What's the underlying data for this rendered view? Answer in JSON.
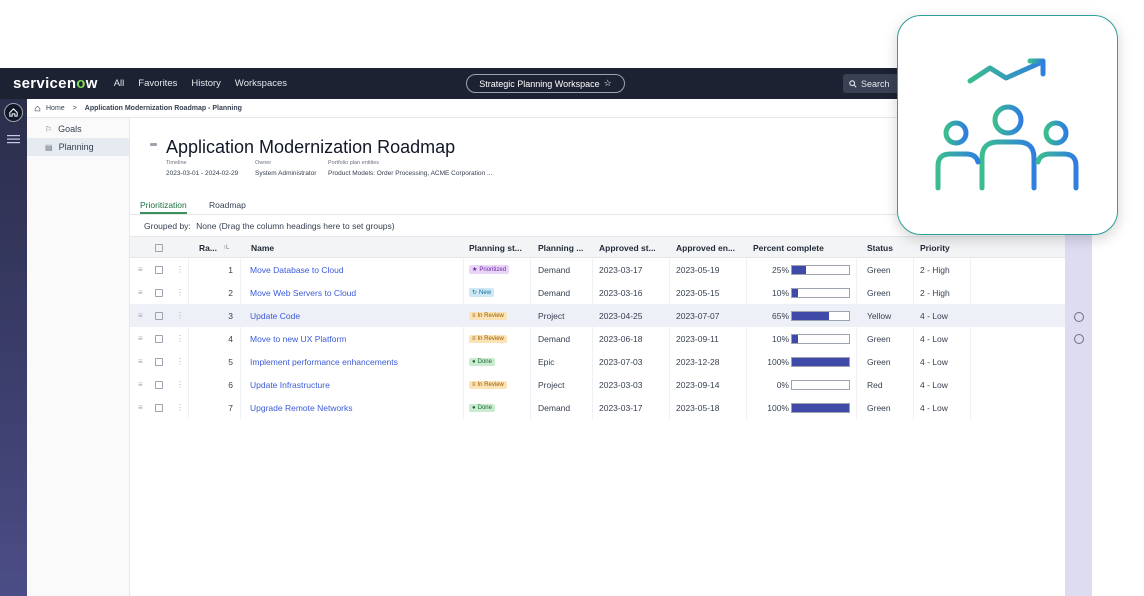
{
  "topbar": {
    "logo_left": "servicen",
    "logo_o": "o",
    "logo_right": "w",
    "nav": [
      "All",
      "Favorites",
      "History",
      "Workspaces"
    ],
    "workspace": "Strategic Planning Workspace",
    "star": "☆",
    "search": "Search"
  },
  "breadcrumb": {
    "home": "Home",
    "sep": ">",
    "current": "Application Modernization Roadmap - Planning"
  },
  "sidenav": {
    "items": [
      {
        "icon": "⚐",
        "label": "Goals"
      },
      {
        "icon": "▤",
        "label": "Planning"
      }
    ]
  },
  "header": {
    "title": "Application Modernization Roadmap",
    "timeline_label": "Timeline",
    "timeline_value": "2023-03-01 - 2024-02-29",
    "owner_label": "Owner",
    "owner_value": "System Administrator",
    "entities_label": "Portfolio plan entities",
    "entities_value": "Product Models: Order Processing, ACME Corporation ..."
  },
  "tabs": [
    "Prioritization",
    "Roadmap"
  ],
  "grouped": {
    "label": "Grouped by:",
    "value": "None (Drag the column headings here to set groups)"
  },
  "table": {
    "columns": [
      "Ra...",
      "Name",
      "Planning st...",
      "Planning ...",
      "Approved st...",
      "Approved en...",
      "Percent complete",
      "Status",
      "Priority"
    ],
    "sort_indicator": "↑L",
    "rows": [
      {
        "rank": "1",
        "name": "Move Database to Cloud",
        "state": "Prioritized",
        "state_icon": "★",
        "type": "Demand",
        "start": "2023-03-17",
        "end": "2023-05-19",
        "pct_label": "25%",
        "pct": 25,
        "status": "Green",
        "priority": "2 - High"
      },
      {
        "rank": "2",
        "name": "Move Web Servers to Cloud",
        "state": "New",
        "state_icon": "↻",
        "type": "Demand",
        "start": "2023-03-16",
        "end": "2023-05-15",
        "pct_label": "10%",
        "pct": 10,
        "status": "Green",
        "priority": "2 - High"
      },
      {
        "rank": "3",
        "name": "Update Code",
        "state": "In Review",
        "state_icon": "≡",
        "type": "Project",
        "start": "2023-04-25",
        "end": "2023-07-07",
        "pct_label": "65%",
        "pct": 65,
        "status": "Yellow",
        "priority": "4 - Low"
      },
      {
        "rank": "4",
        "name": "Move to new UX Platform",
        "state": "In Review",
        "state_icon": "≡",
        "type": "Demand",
        "start": "2023-06-18",
        "end": "2023-09-11",
        "pct_label": "10%",
        "pct": 10,
        "status": "Green",
        "priority": "4 - Low"
      },
      {
        "rank": "5",
        "name": "Implement performance enhancements",
        "state": "Done",
        "state_icon": "●",
        "type": "Epic",
        "start": "2023-07-03",
        "end": "2023-12-28",
        "pct_label": "100%",
        "pct": 100,
        "status": "Green",
        "priority": "4 - Low"
      },
      {
        "rank": "6",
        "name": "Update Infrastructure",
        "state": "In Review",
        "state_icon": "≡",
        "type": "Project",
        "start": "2023-03-03",
        "end": "2023-09-14",
        "pct_label": "0%",
        "pct": 0,
        "status": "Red",
        "priority": "4 - Low"
      },
      {
        "rank": "7",
        "name": "Upgrade Remote Networks",
        "state": "Done",
        "state_icon": "●",
        "type": "Demand",
        "start": "2023-03-17",
        "end": "2023-05-18",
        "pct_label": "100%",
        "pct": 100,
        "status": "Green",
        "priority": "4 - Low"
      }
    ]
  },
  "colors": {
    "topbar": "#1d2233",
    "accent_green": "#7ed957",
    "link": "#3b5bdb",
    "progress": "#3f4aa8",
    "card_gradient_start": "#3bbd8f",
    "card_gradient_end": "#2f7ee0",
    "badges": {
      "Prioritized": {
        "bg": "#e9d5f5",
        "fg": "#6b21a8"
      },
      "New": {
        "bg": "#cfe8f5",
        "fg": "#0e6e99"
      },
      "In Review": {
        "bg": "#fbe3b5",
        "fg": "#9a5b00"
      },
      "Done": {
        "bg": "#c9ecd0",
        "fg": "#1f6b35"
      }
    }
  },
  "floating_card_icon": "team-growth-icon"
}
